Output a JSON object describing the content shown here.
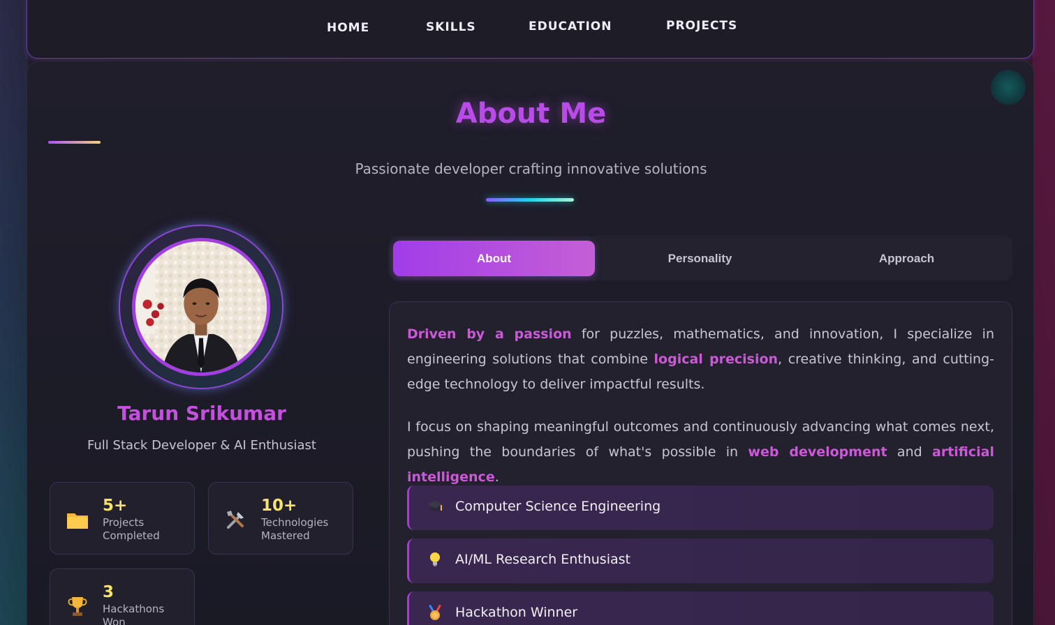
{
  "nav": {
    "items": [
      {
        "label": "HOME"
      },
      {
        "label": "SKILLS"
      },
      {
        "label": "EDUCATION"
      },
      {
        "label": "PROJECTS"
      }
    ]
  },
  "section": {
    "title": "About Me",
    "subtitle": "Passionate developer crafting innovative solutions"
  },
  "profile": {
    "name": "Tarun Srikumar",
    "role": "Full Stack Developer & AI Enthusiast",
    "avatar_icon": "profile-photo"
  },
  "stats": [
    {
      "value": "5+",
      "label": "Projects Completed",
      "icon": "folder-icon"
    },
    {
      "value": "10+",
      "label": "Technologies Mastered",
      "icon": "tools-icon"
    },
    {
      "value": "3",
      "label": "Hackathons Won",
      "icon": "trophy-icon"
    }
  ],
  "tabs": [
    {
      "label": "About",
      "active": true
    },
    {
      "label": "Personality",
      "active": false
    },
    {
      "label": "Approach",
      "active": false
    }
  ],
  "content": {
    "p1": {
      "h1": "Driven by a passion",
      "t1": " for puzzles, mathematics, and innovation, I specialize in engineering solutions that combine ",
      "h2": "logical precision",
      "t2": ", creative thinking, and cutting-edge technology to deliver impactful results."
    },
    "p2": {
      "t1": "I focus on shaping meaningful outcomes and continuously advancing what comes next, pushing the boundaries of what's possible in ",
      "h1": "web development",
      "t2": " and ",
      "h2": "artificial intelligence",
      "t3": "."
    },
    "features": [
      {
        "label": "Computer Science Engineering",
        "icon": "graduation-cap-icon"
      },
      {
        "label": "AI/ML Research Enthusiast",
        "icon": "lightbulb-icon"
      },
      {
        "label": "Hackathon Winner",
        "icon": "medal-icon"
      }
    ]
  },
  "colors": {
    "accent": "#a855f7",
    "highlight": "#cc5ad8",
    "stat_value": "#f7e36a",
    "panel_bg": "#1f1e2a"
  }
}
